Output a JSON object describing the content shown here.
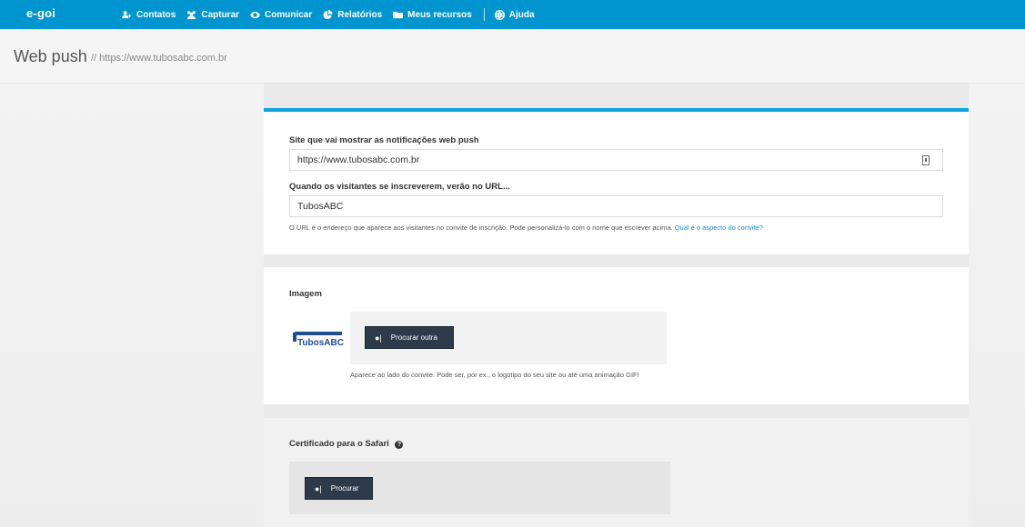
{
  "app": {
    "logo": "e-goi"
  },
  "nav": [
    {
      "label": "Contatos",
      "icon": "contacts-icon"
    },
    {
      "label": "Capturar",
      "icon": "capture-icon"
    },
    {
      "label": "Comunicar",
      "icon": "eye-icon"
    },
    {
      "label": "Relatórios",
      "icon": "pie-chart-icon"
    },
    {
      "label": "Meus recursos",
      "icon": "folder-icon"
    },
    {
      "label": "Ajuda",
      "icon": "globe-icon"
    }
  ],
  "header": {
    "title": "Web push",
    "subtitle": "// https://www.tubosabc.com.br"
  },
  "site_section": {
    "site_label": "Site que vai mostrar as notificações web push",
    "site_value": "https://www.tubosabc.com.br",
    "url_label": "Quando os visitantes se inscreverem, verão no URL...",
    "url_value": "TubosABC",
    "help_text": "O URL é o endereço que aparece aos visitantes no convite de inscrição. Pode personalizá-lo com o nome que escrever acima.",
    "help_link": "Qual é o aspecto do convite?"
  },
  "image_section": {
    "label": "Imagem",
    "button": "Procurar outra",
    "help": "Aparece ao lado do convite. Pode ser, por ex., o logotipo do seu site ou até uma animação GIF!",
    "logo_text": "TubosABC"
  },
  "safari_section": {
    "label": "Certificado para o Safari",
    "button": "Procurar"
  },
  "colors": {
    "topbar": "#0095cf",
    "accent": "#0fa3dc",
    "button": "#2d3a4a",
    "link": "#1a8fc8"
  }
}
